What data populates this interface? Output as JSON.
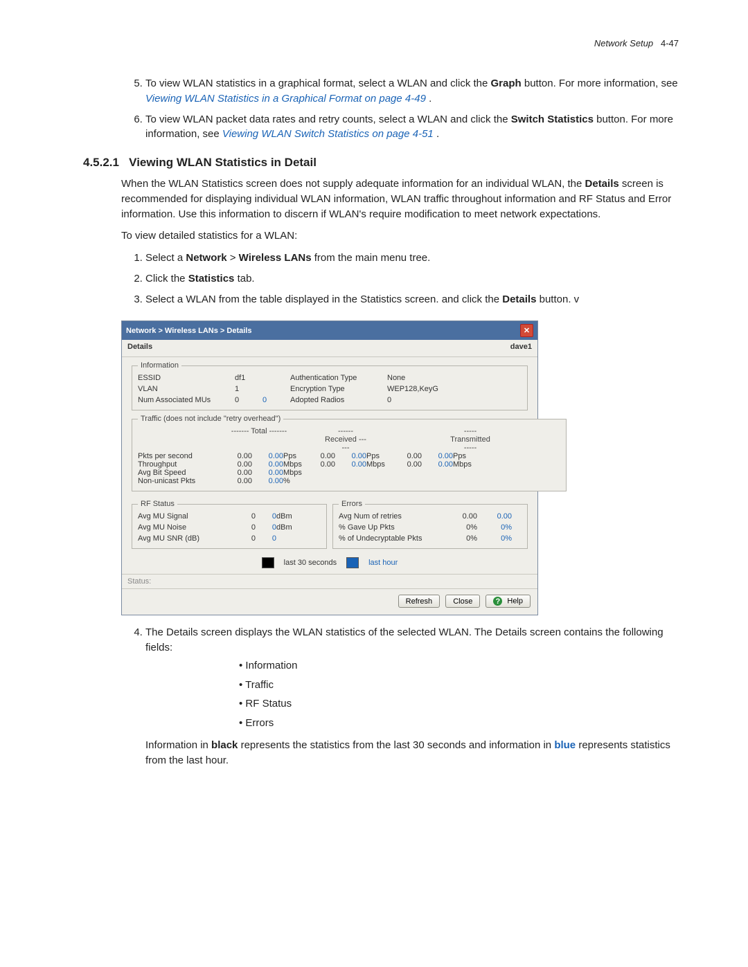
{
  "header": {
    "book": "Network Setup",
    "page": "4-47"
  },
  "intro_steps": [
    {
      "num": 5,
      "lead": "To view WLAN statistics in a graphical format, select a WLAN and click the ",
      "bold1": "Graph",
      "mid": " button. For more information, see ",
      "link": "Viewing WLAN Statistics in a Graphical Format on page 4-49",
      "tail": "."
    },
    {
      "num": 6,
      "lead": "To view WLAN packet data rates and retry counts, select a WLAN and click the ",
      "bold1": "Switch Statistics",
      "mid": " button. For more information, see ",
      "link": "Viewing WLAN Switch Statistics on page 4-51",
      "tail": "."
    }
  ],
  "section": {
    "number": "4.5.2.1",
    "title": "Viewing WLAN Statistics in Detail",
    "para1a": "When the WLAN Statistics screen does not supply adequate information for an individual WLAN, the ",
    "para1_bold": "Details",
    "para1b": " screen is recommended for displaying individual WLAN information, WLAN traffic throughout information and RF Status and Error information. Use this information to discern if WLAN's require modification to meet network expectations.",
    "para2": "To view detailed statistics for a WLAN:",
    "steps": [
      {
        "lead": "Select a ",
        "b1": "Network",
        "mid": " > ",
        "b2": "Wireless LANs",
        "tail": " from the main menu tree."
      },
      {
        "lead": "Click the ",
        "b1": "Statistics",
        "tail": " tab."
      },
      {
        "lead": "Select a WLAN from the table displayed in the Statistics screen. and click the ",
        "b1": "Details",
        "tail": " button. v"
      }
    ],
    "after_img_num": 4,
    "after_img": "The Details screen displays the WLAN statistics of the selected WLAN. The Details screen contains the following fields:",
    "bullets": [
      "Information",
      "Traffic",
      "RF Status",
      "Errors"
    ],
    "footnote_a": "Information in ",
    "footnote_b1": "black",
    "footnote_mid": " represents the statistics from the last 30 seconds and information in ",
    "footnote_b2": "blue",
    "footnote_tail": " represents statistics from the last hour."
  },
  "dialog": {
    "breadcrumb": "Network > Wireless LANs > Details",
    "sub_left": "Details",
    "sub_right": "dave1",
    "info_legend": "Information",
    "info": {
      "essid_l": "ESSID",
      "essid_v": "df1",
      "vlan_l": "VLAN",
      "vlan_v": "1",
      "mus_l": "Num Associated MUs",
      "mus_v1": "0",
      "mus_v2": "0",
      "auth_l": "Authentication Type",
      "auth_v": "None",
      "enc_l": "Encryption Type",
      "enc_v": "WEP128,KeyG",
      "rad_l": "Adopted Radios",
      "rad_v": "0"
    },
    "traffic_legend": "Traffic (does not include \"retry overhead\")",
    "traffic_cols": {
      "total": "------- Total -------",
      "recv": "------ Received ------",
      "tx": "----- Transmitted -----"
    },
    "traffic_rows": [
      {
        "l": "Pkts per second",
        "t1": "0.00",
        "t2": "0.00",
        "tu": "Pps",
        "r1": "0.00",
        "r2": "0.00",
        "ru": "Pps",
        "x1": "0.00",
        "x2": "0.00",
        "xu": "Pps"
      },
      {
        "l": "Throughput",
        "t1": "0.00",
        "t2": "0.00",
        "tu": "Mbps",
        "r1": "0.00",
        "r2": "0.00",
        "ru": "Mbps",
        "x1": "0.00",
        "x2": "0.00",
        "xu": "Mbps"
      },
      {
        "l": "Avg Bit Speed",
        "t1": "0.00",
        "t2": "0.00",
        "tu": "Mbps"
      },
      {
        "l": "Non-unicast Pkts",
        "t1": "0.00",
        "t2": "0.00",
        "tu": "%"
      }
    ],
    "rf_legend": "RF Status",
    "rf_rows": [
      {
        "l": "Avg MU Signal",
        "v1": "0",
        "v2": "0",
        "u": "dBm"
      },
      {
        "l": "Avg MU Noise",
        "v1": "0",
        "v2": "0",
        "u": "dBm"
      },
      {
        "l": "Avg MU SNR (dB)",
        "v1": "0",
        "v2": "0",
        "u": ""
      }
    ],
    "err_legend": "Errors",
    "err_rows": [
      {
        "l": "Avg Num of retries",
        "v1": "0.00",
        "v2": "0.00"
      },
      {
        "l": "% Gave Up Pkts",
        "v1": "0%",
        "v2": "0%"
      },
      {
        "l": "% of Undecryptable Pkts",
        "v1": "0%",
        "v2": "0%"
      }
    ],
    "legend_black": "last 30 seconds",
    "legend_blue": "last hour",
    "status_label": "Status:",
    "btn_refresh": "Refresh",
    "btn_close": "Close",
    "btn_help": "Help"
  }
}
